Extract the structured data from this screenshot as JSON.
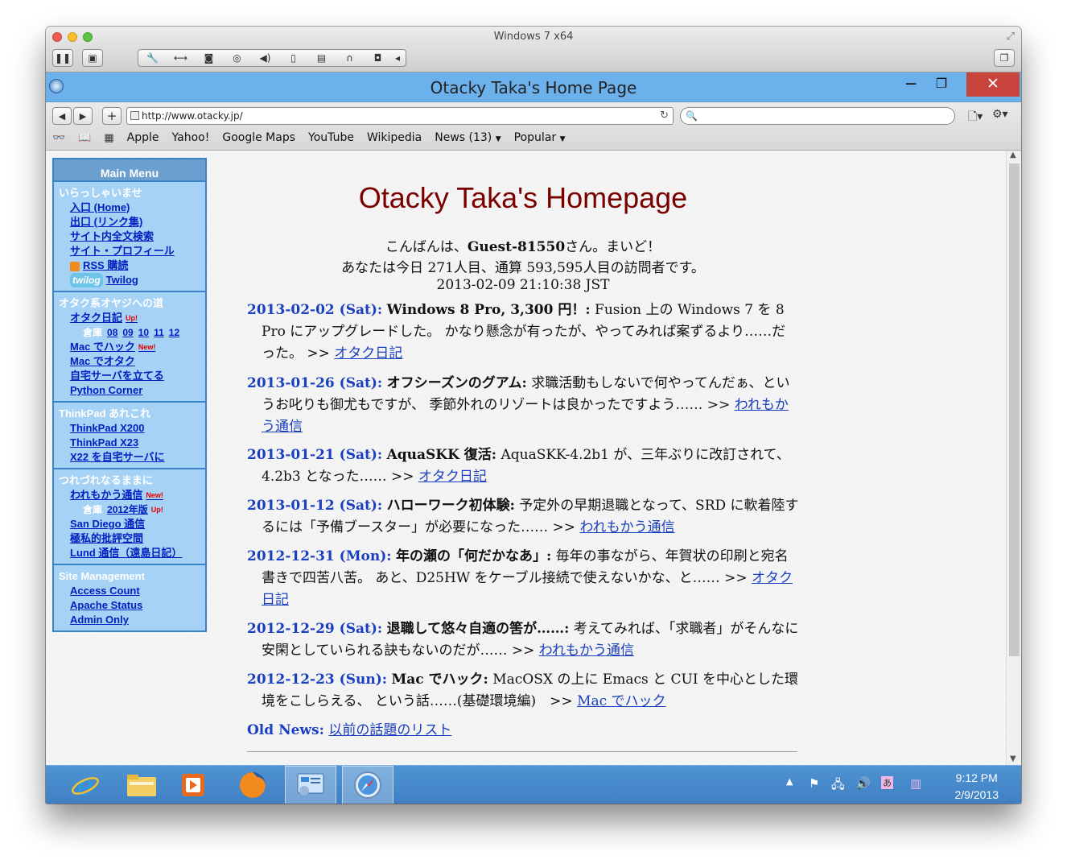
{
  "vm": {
    "title": "Windows 7 x64"
  },
  "browser": {
    "title": "Otacky Taka's Home Page",
    "url": "http://www.otacky.jp/",
    "search_value": "",
    "bookmarks": [
      "Apple",
      "Yahoo!",
      "Google Maps",
      "YouTube",
      "Wikipedia",
      "News (13)",
      "Popular"
    ]
  },
  "menu": {
    "title": "Main Menu",
    "sections": [
      {
        "title": "いらっしゃいませ",
        "items": [
          "入口 (Home)",
          "出口 (リンク集)",
          "サイト内全文検索",
          "サイト・プロフィール",
          "RSS 購読",
          "Twilog"
        ]
      },
      {
        "title": "オタク系オヤジへの道",
        "items": [
          "オタク日記",
          "Mac でハック",
          "Mac でオタク",
          "自宅サーバを立てる",
          "Python Corner"
        ],
        "archive_label": "倉庫",
        "archive_links": [
          "08",
          "09",
          "10",
          "11",
          "12"
        ]
      },
      {
        "title": "ThinkPad あれこれ",
        "items": [
          "ThinkPad X200",
          "ThinkPad X23",
          "X22 を自宅サーバに"
        ]
      },
      {
        "title": "つれづれなるままに",
        "items": [
          "われもかう通信",
          "2012年版",
          "San Diego 通信",
          "極私的批評空間",
          "Lund 通信（遠島日記）"
        ],
        "archive_label": "倉庫"
      },
      {
        "title": "Site Management",
        "items": [
          "Access Count",
          "Apache Status",
          "Admin Only"
        ]
      }
    ],
    "badge_up": "Up!",
    "badge_new": "New!",
    "twilog_logo": "twilog"
  },
  "page": {
    "heading": "Otacky Taka's Homepage",
    "greeting_pre": "こんばんは、",
    "guest": "Guest-81550",
    "greeting_post": "さん。まいど！",
    "visitor_line": "あなたは今日 271人目、通算 593,595人目の訪問者です。",
    "timestamp": "2013-02-09 21:10:38 JST",
    "news": [
      {
        "date": "2013-02-02 (Sat):",
        "title": "Windows 8 Pro, 3,300 円！:",
        "body": "Fusion 上の Windows 7 を 8 Pro にアップグレードした。 かなり懸念が有ったが、やってみれば案ずるより……だった。 >>",
        "link": "オタク日記"
      },
      {
        "date": "2013-01-26 (Sat):",
        "title": "オフシーズンのグアム:",
        "body": "求職活動もしないで何やってんだぁ、というお叱りも御尤もですが、 季節外れのリゾートは良かったですよう…… >>",
        "link": "われもかう通信"
      },
      {
        "date": "2013-01-21 (Sat):",
        "title": "AquaSKK 復活:",
        "body": "AquaSKK-4.2b1 が、三年ぶりに改訂されて、4.2b3 となった…… >>",
        "link": "オタク日記"
      },
      {
        "date": "2013-01-12 (Sat):",
        "title": "ハローワーク初体験:",
        "body": "予定外の早期退職となって、SRD に軟着陸するには「予備ブースター」が必要になった…… >>",
        "link": "われもかう通信"
      },
      {
        "date": "2012-12-31 (Mon):",
        "title": "年の瀬の「何だかなあ」:",
        "body": "毎年の事ながら、年賀状の印刷と宛名書きで四苦八苦。 あと、D25HW をケーブル接続で使えないかな、と…… >>",
        "link": "オタク日記"
      },
      {
        "date": "2012-12-29 (Sat):",
        "title": "退職して悠々自適の筈が……:",
        "body": "考えてみれば、「求職者」がそんなに安閑としていられる訣もないのだが…… >>",
        "link": "われもかう通信"
      },
      {
        "date": "2012-12-23 (Sun):",
        "title": "Mac でハック:",
        "body": "MacOSX の上に Emacs と CUI を中心とした環境をこしらえる、 という話……(基礎環境編)　>>",
        "link": "Mac でハック"
      }
    ],
    "old_news_label": "Old News:",
    "old_news_link": "以前の話題のリスト"
  },
  "taskbar": {
    "time": "9:12 PM",
    "date": "2/9/2013"
  }
}
